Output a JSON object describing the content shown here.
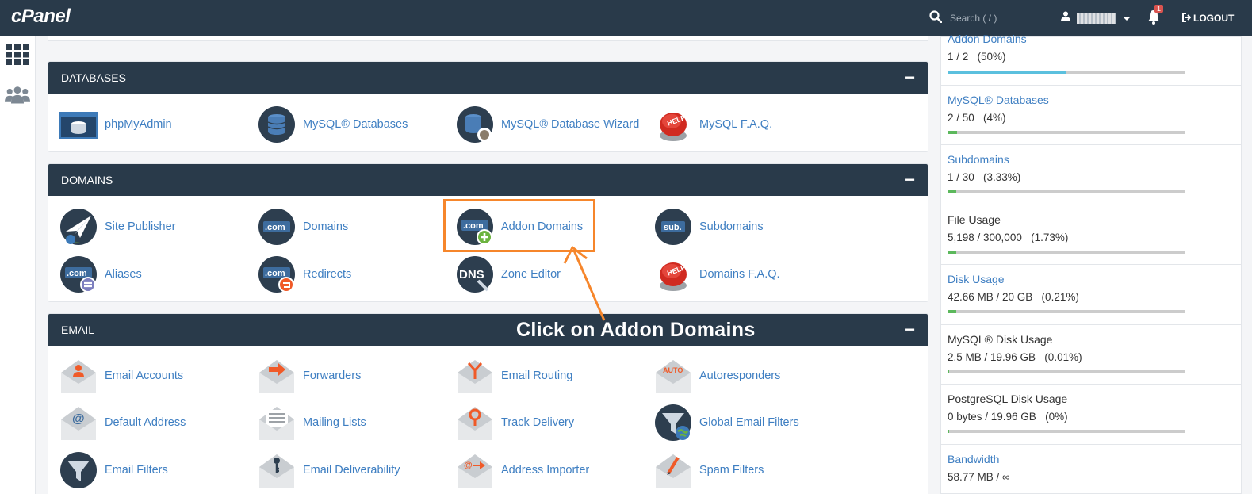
{
  "topbar": {
    "logo": "cPanel",
    "search_placeholder": "Search ( / )",
    "notification_count": "1",
    "logout_label": "LOGOUT"
  },
  "groups": {
    "databases": {
      "title": "DATABASES",
      "items": [
        "phpMyAdmin",
        "MySQL® Databases",
        "MySQL® Database Wizard",
        "MySQL F.A.Q."
      ]
    },
    "domains": {
      "title": "DOMAINS",
      "items": [
        "Site Publisher",
        "Domains",
        "Addon Domains",
        "Subdomains",
        "Aliases",
        "Redirects",
        "Zone Editor",
        "Domains F.A.Q."
      ]
    },
    "email": {
      "title": "EMAIL",
      "items": [
        "Email Accounts",
        "Forwarders",
        "Email Routing",
        "Autoresponders",
        "Default Address",
        "Mailing Lists",
        "Track Delivery",
        "Global Email Filters",
        "Email Filters",
        "Email Deliverability",
        "Address Importer",
        "Spam Filters"
      ]
    }
  },
  "annotation": {
    "callout": "Click on Addon Domains",
    "color": "#f6862b"
  },
  "stats": [
    {
      "label": "Addon Domains",
      "value": "1 / 2   (50%)",
      "fraction": 0.5,
      "color": "#5bc0de"
    },
    {
      "label": "MySQL® Databases",
      "value": "2 / 50   (4%)",
      "fraction": 0.04,
      "color": "#5cb85c"
    },
    {
      "label": "Subdomains",
      "value": "1 / 30   (3.33%)",
      "fraction": 0.033,
      "color": "#5cb85c"
    },
    {
      "label": "File Usage",
      "value": "5,198 / 300,000   (1.73%)",
      "fraction": 0.017,
      "color": "#5cb85c"
    },
    {
      "label": "Disk Usage",
      "value": "42.66 MB / 20 GB   (0.21%)",
      "fraction": 0.002,
      "color": "#5cb85c"
    },
    {
      "label": "MySQL® Disk Usage",
      "value": "2.5 MB / 19.96 GB   (0.01%)",
      "fraction": 0.0,
      "color": "#5cb85c"
    },
    {
      "label": "PostgreSQL Disk Usage",
      "value": "0 bytes / 19.96 GB   (0%)",
      "fraction": 0.0,
      "color": "#5cb85c"
    },
    {
      "label": "Bandwidth",
      "value": "58.77 MB / ∞",
      "fraction": 0.0,
      "color": "#5cb85c"
    }
  ]
}
